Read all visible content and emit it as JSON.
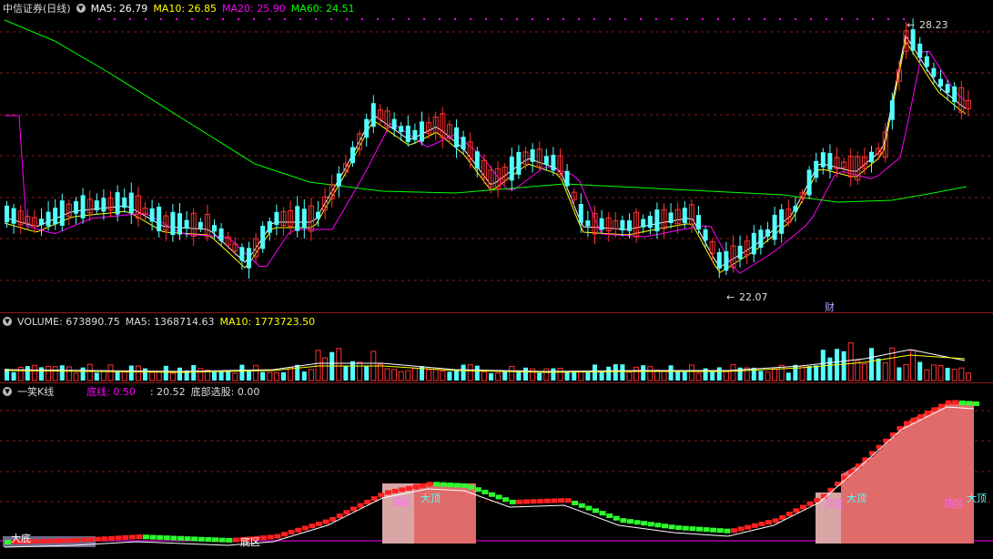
{
  "price": {
    "title": "中信证券(日线)",
    "ma": [
      {
        "label": "MA5: 26.79",
        "color": "#ffffff"
      },
      {
        "label": "MA10: 26.85",
        "color": "#ffff00"
      },
      {
        "label": "MA20: 25.90",
        "color": "#ff00ff"
      },
      {
        "label": "MA60: 24.51",
        "color": "#00ff00"
      }
    ],
    "high_label": "28.23",
    "low_label": "22.07",
    "cai_label": "财"
  },
  "volume": {
    "label_vol": "VOLUME: 673890.75",
    "label_ma5": "MA5: 1368714.63",
    "label_ma10": "MA10: 1773723.50"
  },
  "indicator": {
    "title": "一笑K线",
    "bottom_line": "底线: 0.50",
    "value": ": 20.52",
    "bottom_pick": "底部选股: 0.00",
    "tags": {
      "big_bottom": "大底",
      "bottom_zone": "底区",
      "top_zone_1": "顶区",
      "big_top_1": "大顶",
      "top_zone_2": "顶区",
      "big_top_2": "大顶",
      "top_zone_3": "顶区",
      "big_top_3": "大顶"
    }
  },
  "colors": {
    "up": "#ff3232",
    "down": "#54ffff",
    "ma5": "#ffffff",
    "ma10": "#ffff00",
    "ma20": "#ff00ff",
    "ma60": "#00ff00",
    "grid": "#8a1a1a"
  }
}
